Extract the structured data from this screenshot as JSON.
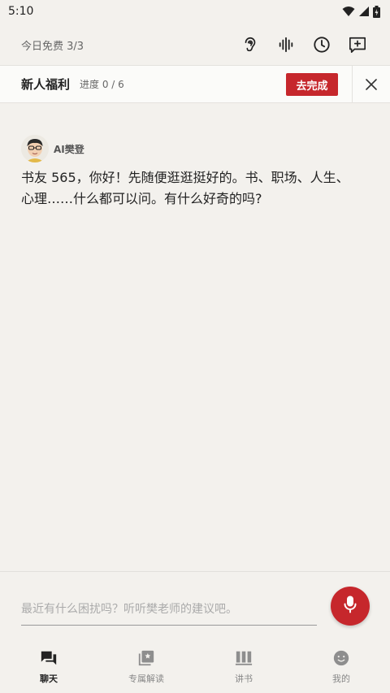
{
  "status_bar": {
    "time": "5:10"
  },
  "header": {
    "free_count": "今日免费 3/3"
  },
  "banner": {
    "title": "新人福利",
    "progress": "进度 0 / 6",
    "cta_label": "去完成"
  },
  "chat": {
    "sender_name": "AI樊登",
    "message": "书友 565，你好！先随便逛逛挺好的。书、职场、人生、心理……什么都可以问。有什么好奇的吗?"
  },
  "input": {
    "placeholder": "最近有什么困扰吗？听听樊老师的建议吧。"
  },
  "bottom_nav": {
    "items": [
      {
        "label": "聊天",
        "icon": "chat-icon",
        "active": true
      },
      {
        "label": "专属解读",
        "icon": "collection-icon",
        "active": false
      },
      {
        "label": "讲书",
        "icon": "books-icon",
        "active": false
      },
      {
        "label": "我的",
        "icon": "face-icon",
        "active": false
      }
    ]
  },
  "colors": {
    "accent": "#c6272c",
    "background": "#f3f1ed",
    "banner_bg": "#fbfbf9"
  }
}
